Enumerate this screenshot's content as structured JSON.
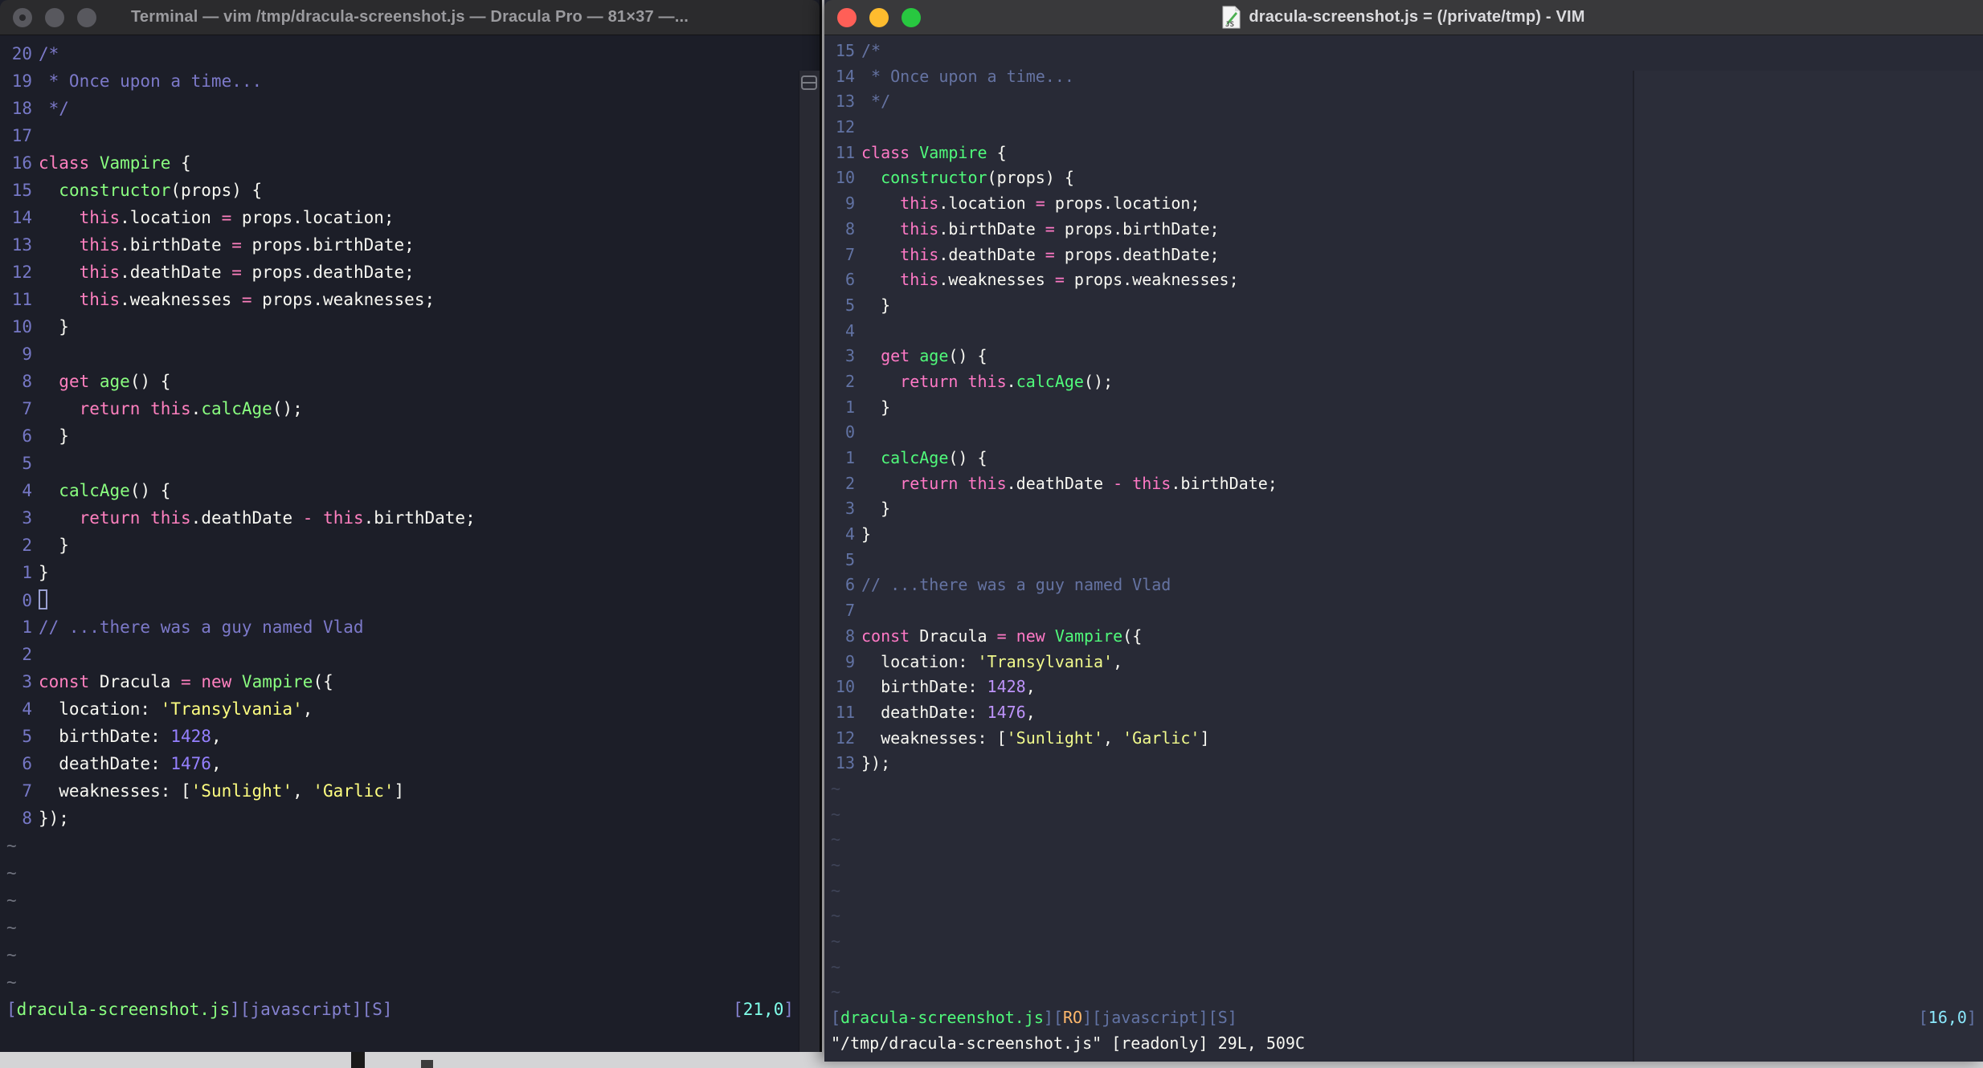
{
  "desktop": {
    "background_color": "#D4D4D6"
  },
  "code_lines": [
    [
      [
        "comment",
        "/*"
      ]
    ],
    [
      [
        "comment",
        " * Once upon a time..."
      ]
    ],
    [
      [
        "comment",
        " */"
      ]
    ],
    [],
    [
      [
        "pink",
        "class"
      ],
      [
        "fg",
        " "
      ],
      [
        "green",
        "Vampire"
      ],
      [
        "fg",
        " {"
      ]
    ],
    [
      [
        "fg",
        "  "
      ],
      [
        "green",
        "constructor"
      ],
      [
        "fg",
        "(props) {"
      ]
    ],
    [
      [
        "fg",
        "    "
      ],
      [
        "pink",
        "this"
      ],
      [
        "fg",
        ".location "
      ],
      [
        "pink",
        "="
      ],
      [
        "fg",
        " props.location;"
      ]
    ],
    [
      [
        "fg",
        "    "
      ],
      [
        "pink",
        "this"
      ],
      [
        "fg",
        ".birthDate "
      ],
      [
        "pink",
        "="
      ],
      [
        "fg",
        " props.birthDate;"
      ]
    ],
    [
      [
        "fg",
        "    "
      ],
      [
        "pink",
        "this"
      ],
      [
        "fg",
        ".deathDate "
      ],
      [
        "pink",
        "="
      ],
      [
        "fg",
        " props.deathDate;"
      ]
    ],
    [
      [
        "fg",
        "    "
      ],
      [
        "pink",
        "this"
      ],
      [
        "fg",
        ".weaknesses "
      ],
      [
        "pink",
        "="
      ],
      [
        "fg",
        " props.weaknesses;"
      ]
    ],
    [
      [
        "fg",
        "  }"
      ]
    ],
    [],
    [
      [
        "fg",
        "  "
      ],
      [
        "pink",
        "get"
      ],
      [
        "fg",
        " "
      ],
      [
        "green",
        "age"
      ],
      [
        "fg",
        "() {"
      ]
    ],
    [
      [
        "fg",
        "    "
      ],
      [
        "pink",
        "return"
      ],
      [
        "fg",
        " "
      ],
      [
        "pink",
        "this"
      ],
      [
        "fg",
        "."
      ],
      [
        "green",
        "calcAge"
      ],
      [
        "fg",
        "();"
      ]
    ],
    [
      [
        "fg",
        "  }"
      ]
    ],
    [],
    [
      [
        "fg",
        "  "
      ],
      [
        "green",
        "calcAge"
      ],
      [
        "fg",
        "() {"
      ]
    ],
    [
      [
        "fg",
        "    "
      ],
      [
        "pink",
        "return"
      ],
      [
        "fg",
        " "
      ],
      [
        "pink",
        "this"
      ],
      [
        "fg",
        ".deathDate "
      ],
      [
        "pink",
        "-"
      ],
      [
        "fg",
        " "
      ],
      [
        "pink",
        "this"
      ],
      [
        "fg",
        ".birthDate;"
      ]
    ],
    [
      [
        "fg",
        "  }"
      ]
    ],
    [
      [
        "fg",
        "}"
      ]
    ],
    [],
    [
      [
        "comment",
        "// ...there was a guy named Vlad"
      ]
    ],
    [],
    [
      [
        "pink",
        "const"
      ],
      [
        "fg",
        " Dracula "
      ],
      [
        "pink",
        "="
      ],
      [
        "fg",
        " "
      ],
      [
        "pink",
        "new"
      ],
      [
        "fg",
        " "
      ],
      [
        "green",
        "Vampire"
      ],
      [
        "fg",
        "({"
      ]
    ],
    [
      [
        "fg",
        "  location: "
      ],
      [
        "yellow",
        "'Transylvania'"
      ],
      [
        "fg",
        ","
      ]
    ],
    [
      [
        "fg",
        "  birthDate: "
      ],
      [
        "purple",
        "1428"
      ],
      [
        "fg",
        ","
      ]
    ],
    [
      [
        "fg",
        "  deathDate: "
      ],
      [
        "purple",
        "1476"
      ],
      [
        "fg",
        ","
      ]
    ],
    [
      [
        "fg",
        "  weaknesses: ["
      ],
      [
        "yellow",
        "'Sunlight'"
      ],
      [
        "fg",
        ", "
      ],
      [
        "yellow",
        "'Garlic'"
      ],
      [
        "fg",
        "]"
      ]
    ],
    [
      [
        "fg",
        "});"
      ]
    ]
  ],
  "left_window": {
    "titlebar": {
      "title": "Terminal — vim /tmp/dracula-screenshot.js — Dracula Pro — 81×37 —...",
      "lights": [
        {
          "name": "close-button",
          "color": "#58585E",
          "dot": true
        },
        {
          "name": "minimize-button",
          "color": "#58585E",
          "dot": false
        },
        {
          "name": "zoom-button",
          "color": "#58585E",
          "dot": false
        }
      ]
    },
    "palette": {
      "bg": "#1C1E28",
      "fg": "#F8F8F2",
      "pink": "#FF80BF",
      "green": "#8AFF80",
      "yellow": "#FFFF80",
      "purple": "#9580FF",
      "comment": "#7C79C9",
      "lnum": "#7678C6",
      "bracket": "#8481CF",
      "label": "#8481CF",
      "orange": "#FFCA80",
      "cyan": "#80FFEA",
      "tilde": "#6F727E"
    },
    "view": {
      "line_numbers": [
        "20",
        "19",
        "18",
        "17",
        "16",
        "15",
        "14",
        "13",
        "12",
        "11",
        "10",
        "9",
        "8",
        "7",
        "6",
        "5",
        "4",
        "3",
        "2",
        "1",
        "0",
        "1",
        "2",
        "3",
        "4",
        "5",
        "6",
        "7",
        "8"
      ],
      "cursor_row": 20,
      "tilde_rows": 6
    },
    "status": {
      "left": [
        [
          "bracket",
          "["
        ],
        [
          "green",
          "dracula-screenshot.js"
        ],
        [
          "bracket",
          "]["
        ],
        [
          "label",
          "javascript"
        ],
        [
          "bracket",
          "]["
        ],
        [
          "label",
          "S"
        ],
        [
          "bracket",
          "]"
        ]
      ],
      "right": [
        [
          "bracket",
          "["
        ],
        [
          "cyan",
          "21,0"
        ],
        [
          "bracket",
          "]"
        ]
      ]
    },
    "command_line": ""
  },
  "right_window": {
    "titlebar": {
      "title": "dracula-screenshot.js = (/private/tmp) - VIM",
      "file_icon": "js-document-icon",
      "lights": [
        {
          "name": "close-button",
          "color": "#FF5F57",
          "dot": false
        },
        {
          "name": "minimize-button",
          "color": "#FEBC2E",
          "dot": false
        },
        {
          "name": "zoom-button",
          "color": "#28C840",
          "dot": false
        }
      ]
    },
    "palette": {
      "bg": "#282A36",
      "fg": "#F8F8F2",
      "pink": "#FF79C6",
      "green": "#50FA7B",
      "yellow": "#F1FA8C",
      "purple": "#BD93F9",
      "comment": "#6573A2",
      "lnum": "#6273A4",
      "bracket": "#6273A4",
      "label": "#6273A4",
      "orange": "#FFB86C",
      "cyan": "#8BE9FD",
      "tilde": "#3F4458"
    },
    "view": {
      "line_numbers": [
        "15",
        "14",
        "13",
        "12",
        "11",
        "10",
        "9",
        "8",
        "7",
        "6",
        "5",
        "4",
        "3",
        "2",
        "1",
        "0",
        "1",
        "2",
        "3",
        "4",
        "5",
        "6",
        "7",
        "8",
        "9",
        "10",
        "11",
        "12",
        "13"
      ],
      "cursor_row": null,
      "tilde_rows": 9
    },
    "status": {
      "left": [
        [
          "bracket",
          "["
        ],
        [
          "green",
          "dracula-screenshot.js"
        ],
        [
          "bracket",
          "]["
        ],
        [
          "orange",
          "RO"
        ],
        [
          "bracket",
          "]["
        ],
        [
          "label",
          "javascript"
        ],
        [
          "bracket",
          "]["
        ],
        [
          "label",
          "S"
        ],
        [
          "bracket",
          "]"
        ]
      ],
      "right": [
        [
          "bracket",
          "["
        ],
        [
          "cyan",
          "16,0"
        ],
        [
          "bracket",
          "]"
        ]
      ]
    },
    "command_line": "\"/tmp/dracula-screenshot.js\" [readonly] 29L, 509C"
  }
}
